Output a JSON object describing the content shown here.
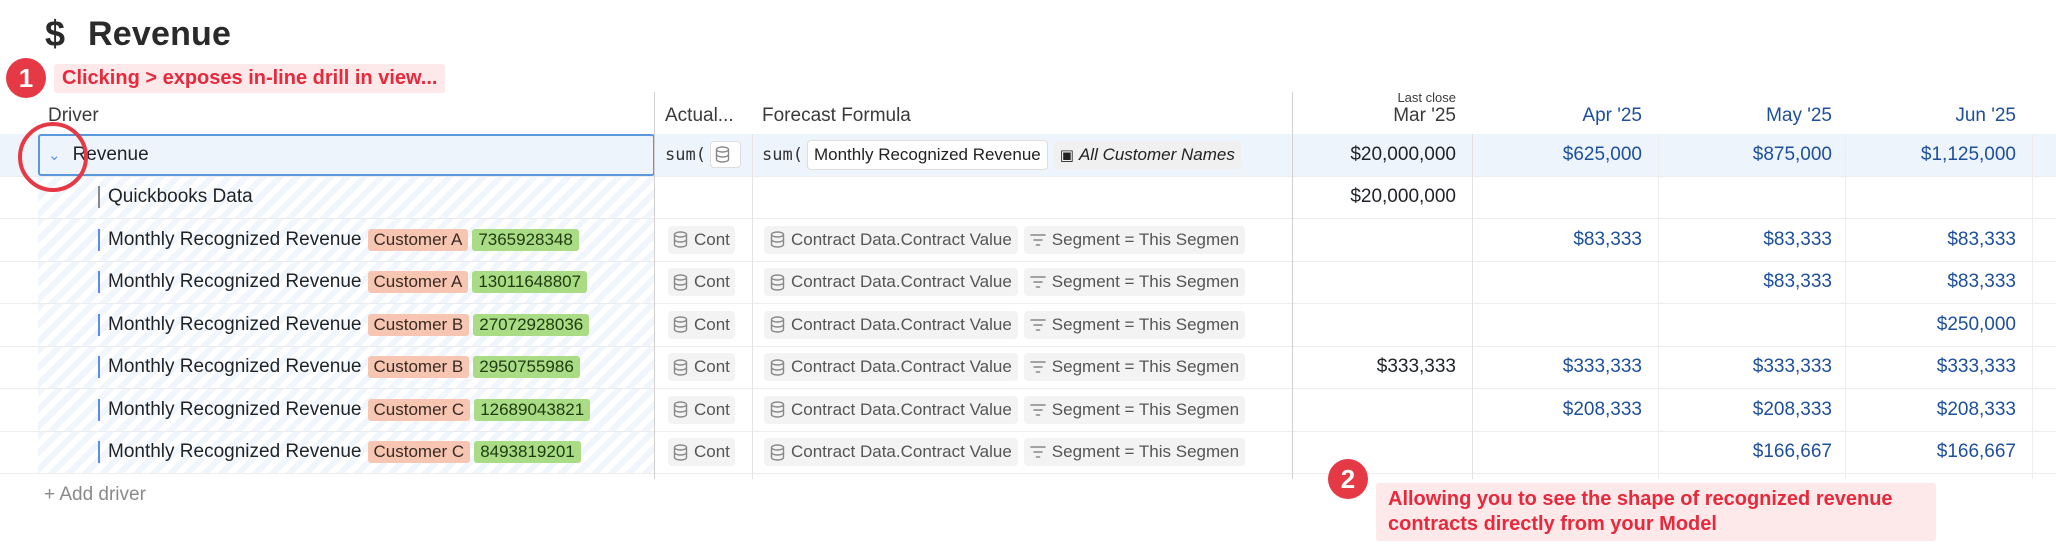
{
  "title": {
    "icon": "dollar-icon",
    "text": "Revenue"
  },
  "callouts": [
    {
      "number": "1",
      "text": "Clicking > exposes in-line drill in view..."
    },
    {
      "number": "2",
      "text": "Allowing you to see the shape of recognized revenue contracts directly from your Model"
    }
  ],
  "headers": {
    "driver": "Driver",
    "actual": "Actual...",
    "forecast": "Forecast Formula",
    "last_close": "Last close",
    "months": [
      "Mar '25",
      "Apr '25",
      "May '25",
      "Jun '25"
    ]
  },
  "revenue_row": {
    "label": "Revenue",
    "actual_formula": "sum(",
    "forecast_formula": "sum(",
    "forecast_ref": "Monthly Recognized Revenue",
    "forecast_dim": "All Customer Names",
    "values": [
      "$20,000,000",
      "$625,000",
      "$875,000",
      "$1,125,000"
    ]
  },
  "quickbooks_row": {
    "label": "Quickbooks Data",
    "values": [
      "$20,000,000",
      "",
      "",
      ""
    ]
  },
  "rows": [
    {
      "label": "Monthly Recognized Revenue",
      "customer": "Customer A",
      "id": "7365928348",
      "actual": "Cont",
      "formula": "Contract Data.Contract Value",
      "filter": "Segment = This Segmen",
      "values": [
        "",
        "$83,333",
        "$83,333",
        "$83,333"
      ]
    },
    {
      "label": "Monthly Recognized Revenue",
      "customer": "Customer A",
      "id": "13011648807",
      "actual": "Cont",
      "formula": "Contract Data.Contract Value",
      "filter": "Segment = This Segmen",
      "values": [
        "",
        "",
        "$83,333",
        "$83,333"
      ]
    },
    {
      "label": "Monthly Recognized Revenue",
      "customer": "Customer B",
      "id": "27072928036",
      "actual": "Cont",
      "formula": "Contract Data.Contract Value",
      "filter": "Segment = This Segmen",
      "values": [
        "",
        "",
        "",
        "$250,000"
      ]
    },
    {
      "label": "Monthly Recognized Revenue",
      "customer": "Customer B",
      "id": "2950755986",
      "actual": "Cont",
      "formula": "Contract Data.Contract Value",
      "filter": "Segment = This Segmen",
      "values": [
        "$333,333",
        "$333,333",
        "$333,333",
        "$333,333"
      ]
    },
    {
      "label": "Monthly Recognized Revenue",
      "customer": "Customer C",
      "id": "12689043821",
      "actual": "Cont",
      "formula": "Contract Data.Contract Value",
      "filter": "Segment = This Segmen",
      "values": [
        "",
        "$208,333",
        "$208,333",
        "$208,333"
      ]
    },
    {
      "label": "Monthly Recognized Revenue",
      "customer": "Customer C",
      "id": "8493819201",
      "actual": "Cont",
      "formula": "Contract Data.Contract Value",
      "filter": "Segment = This Segmen",
      "values": [
        "",
        "",
        "$166,667",
        "$166,667"
      ]
    }
  ],
  "add_driver": "+ Add driver",
  "colors": {
    "accent": "#e63946",
    "month_text": "#1d4f9c",
    "selection": "#5b97db",
    "customer_tag": "#f6c6b3",
    "id_tag": "#a9dc85"
  }
}
